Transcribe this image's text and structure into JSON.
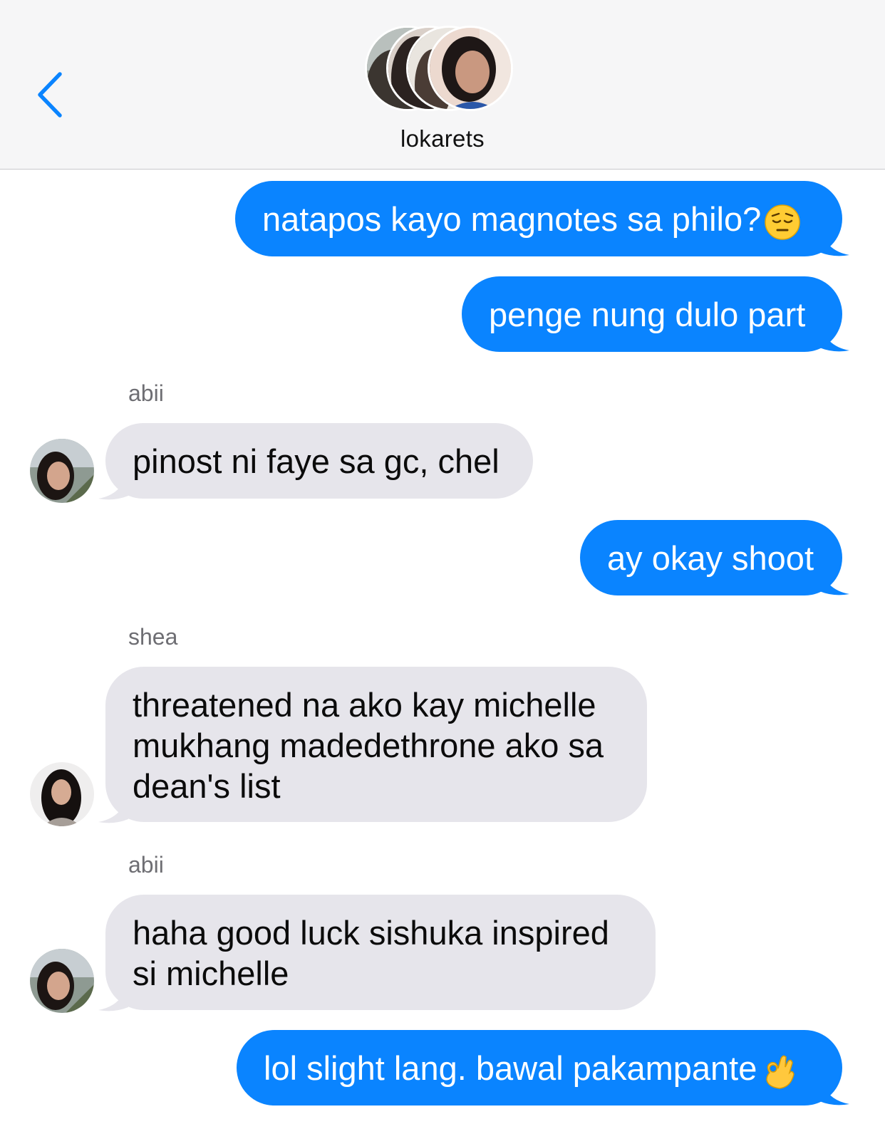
{
  "header": {
    "title": "lokarets",
    "back_icon": "chevron-left-icon",
    "accent": "#0a84ff"
  },
  "messages": [
    {
      "direction": "out",
      "text": "natapos kayo magnotes sa philo?",
      "emoji": "pensive-face-emoji"
    },
    {
      "direction": "out",
      "text": "penge nung dulo part"
    },
    {
      "direction": "in",
      "sender": "abii",
      "text": "pinost ni faye sa gc, chel"
    },
    {
      "direction": "out",
      "text": "ay okay shoot"
    },
    {
      "direction": "in",
      "sender": "shea",
      "lines": [
        "threatened na ako kay michelle",
        "mukhang madedethrone ako sa",
        "dean's list"
      ]
    },
    {
      "direction": "in",
      "sender": "abii",
      "lines": [
        "haha good luck sishuka inspired",
        "si michelle"
      ]
    },
    {
      "direction": "out",
      "text": "lol slight lang. bawal pakampante",
      "emoji": "ok-hand-emoji"
    }
  ],
  "colors": {
    "outgoing_bubble": "#0a84ff",
    "incoming_bubble": "#e6e5eb",
    "header_bg": "#f6f6f7"
  }
}
